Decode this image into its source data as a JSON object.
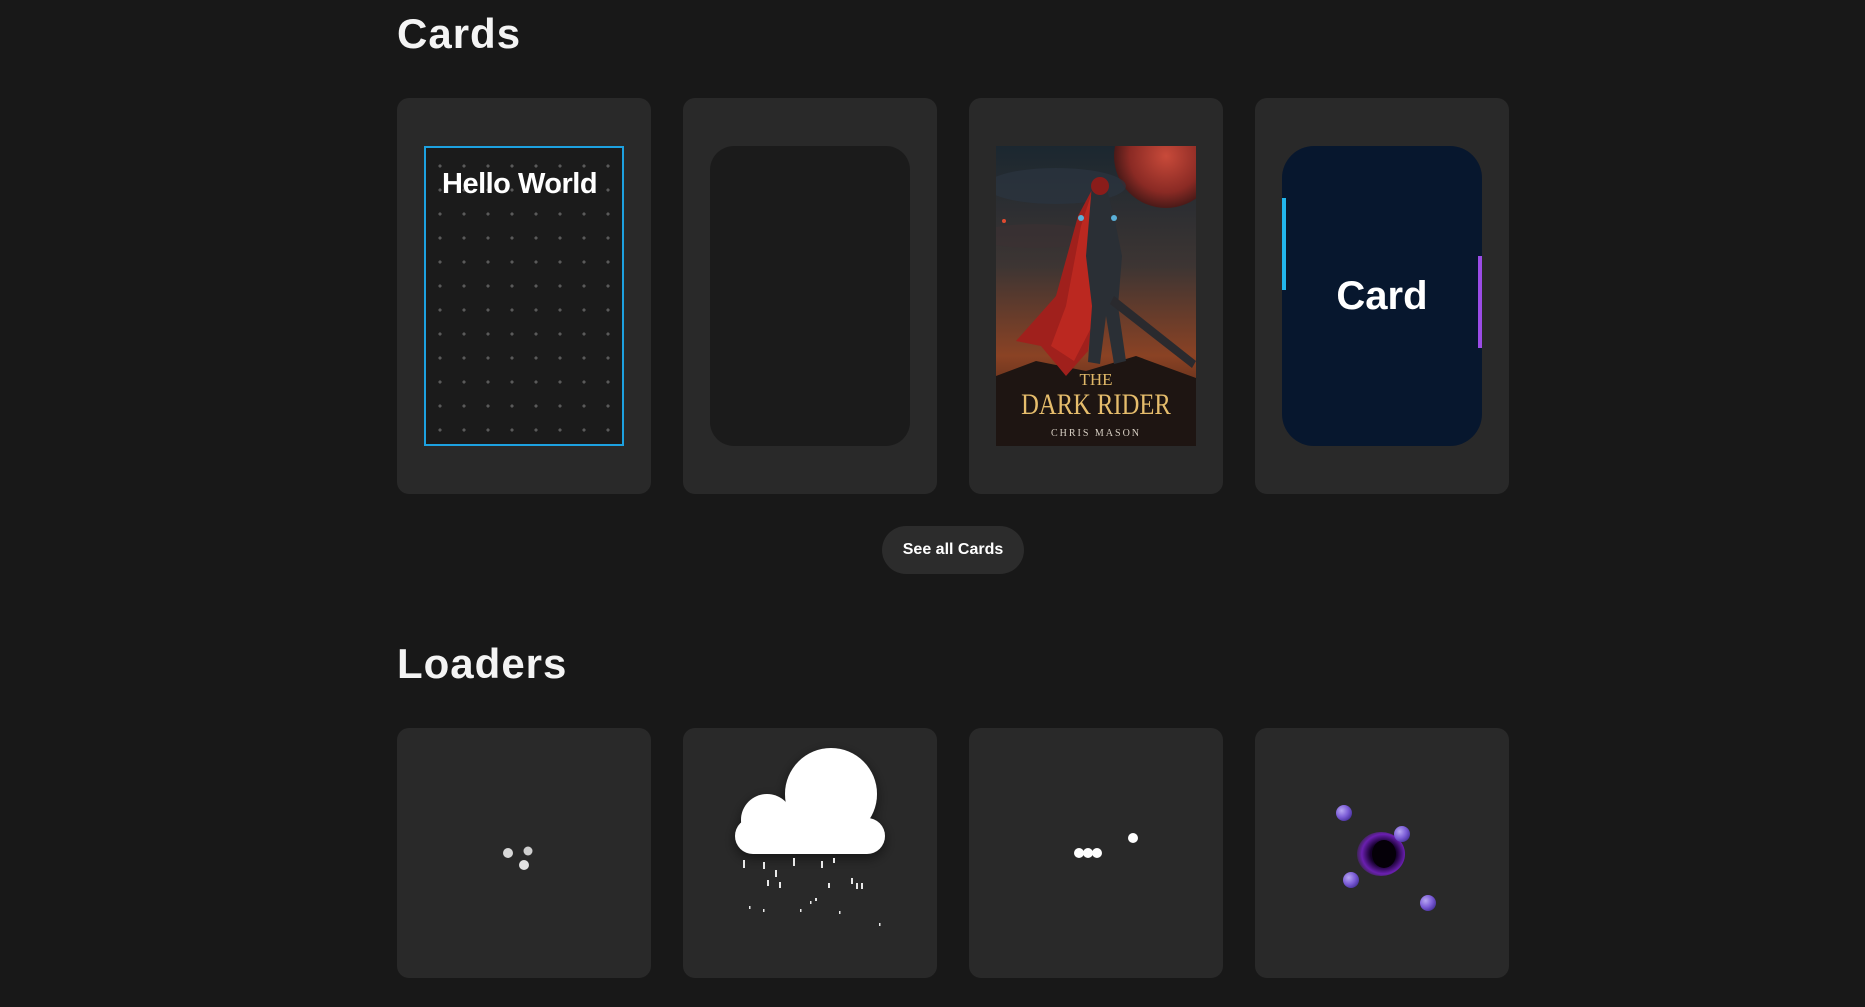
{
  "sections": {
    "cards": {
      "title": "Cards",
      "items": [
        {
          "label": "Hello World",
          "accent": "#1da1e0"
        },
        {
          "label": ""
        },
        {
          "book": {
            "title_line1": "THE",
            "title_line2": "DARK RIDER",
            "author": "CHRIS MASON"
          }
        },
        {
          "label": "Card",
          "accents": [
            "#22b6ec",
            "#9b4ce6"
          ]
        }
      ],
      "see_all_label": "See all Cards"
    },
    "loaders": {
      "title": "Loaders",
      "items": [
        {
          "icon": "dots-spinner-icon"
        },
        {
          "icon": "rain-cloud-icon"
        },
        {
          "icon": "bouncing-dots-icon"
        },
        {
          "icon": "orbit-planet-icon"
        }
      ]
    }
  },
  "colors": {
    "background": "#181818",
    "tile": "#292929",
    "navy": "#07172e",
    "planet_purple": "#7b5cd6"
  }
}
